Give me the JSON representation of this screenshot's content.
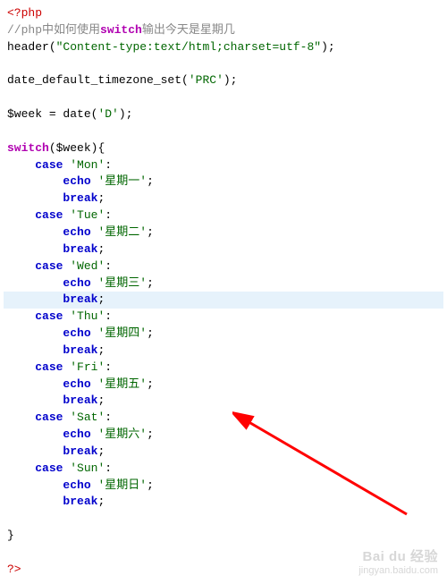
{
  "code": {
    "open_tag": "<?php",
    "comment_prefix": "//php中如何使用",
    "comment_kw": "switch",
    "comment_suffix": "输出今天是星期几",
    "header_call": "header",
    "header_arg": "\"Content-type:text/html;charset=utf-8\"",
    "tz_call": "date_default_timezone_set",
    "tz_arg": "'PRC'",
    "week_var": "$week",
    "date_call": "date",
    "date_arg": "'D'",
    "switch_kw": "switch",
    "case_kw": "case",
    "echo_kw": "echo",
    "break_kw": "break",
    "close_tag": "?>",
    "cases": [
      {
        "match": "'Mon'",
        "out": "'星期一'"
      },
      {
        "match": "'Tue'",
        "out": "'星期二'"
      },
      {
        "match": "'Wed'",
        "out": "'星期三'"
      },
      {
        "match": "'Thu'",
        "out": "'星期四'"
      },
      {
        "match": "'Fri'",
        "out": "'星期五'"
      },
      {
        "match": "'Sat'",
        "out": "'星期六'"
      },
      {
        "match": "'Sun'",
        "out": "'星期日'"
      }
    ]
  },
  "watermark": {
    "brand": "Bai du 经验",
    "url": "jingyan.baidu.com"
  }
}
